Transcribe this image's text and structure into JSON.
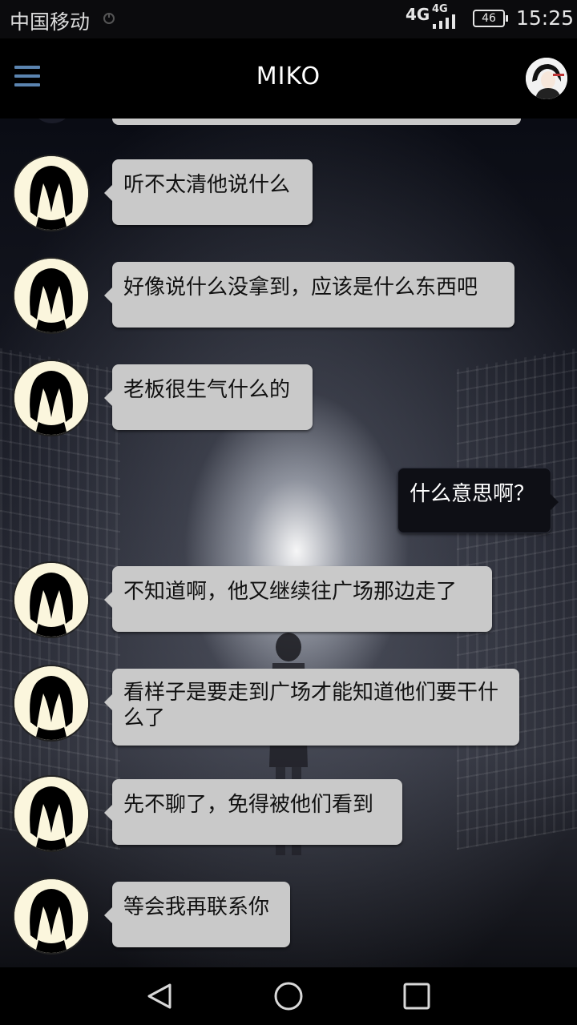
{
  "status_bar": {
    "carrier": "中国移动",
    "network_primary": "4G",
    "network_secondary": "4G",
    "battery": "46",
    "time": "15:25"
  },
  "app_bar": {
    "title": "MIKO",
    "menu_icon": "hamburger-menu-icon",
    "avatar": "user-avatar"
  },
  "messages": [
    {
      "sender": "miko",
      "text": "听不太清他说什么"
    },
    {
      "sender": "miko",
      "text": "好像说什么没拿到，应该是什么东西吧"
    },
    {
      "sender": "miko",
      "text": "老板很生气什么的"
    },
    {
      "sender": "me",
      "text": "什么意思啊？"
    },
    {
      "sender": "miko",
      "text": "不知道啊，他又继续往广场那边走了"
    },
    {
      "sender": "miko",
      "text": "看样子是要走到广场才能知道他们要干什么了"
    },
    {
      "sender": "miko",
      "text": "先不聊了，免得被他们看到"
    },
    {
      "sender": "miko",
      "text": "等会我再联系你"
    }
  ],
  "colors": {
    "incoming_bubble": "#c9c9c9",
    "outgoing_bubble": "#0e0f15",
    "menu_accent": "#5b84b0"
  },
  "nav_bar": {
    "back_icon": "back-triangle-icon",
    "home_icon": "home-circle-icon",
    "recents_icon": "recents-square-icon"
  }
}
